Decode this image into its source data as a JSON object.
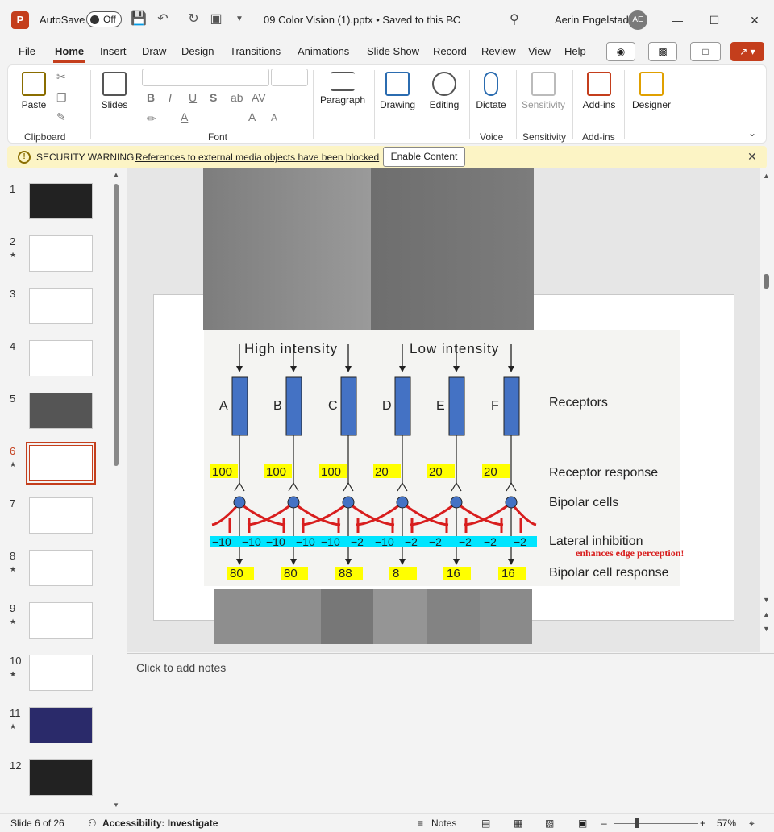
{
  "title_bar": {
    "autosave_label": "AutoSave",
    "autosave_state": "Off",
    "document_title": "09 Color Vision (1).pptx • Saved to this PC",
    "user_name": "Aerin Engelstad",
    "user_initials": "AE"
  },
  "menu": {
    "items": [
      "File",
      "Home",
      "Insert",
      "Draw",
      "Design",
      "Transitions",
      "Animations",
      "Slide Show",
      "Record",
      "Review",
      "View",
      "Help"
    ],
    "active": "Home"
  },
  "ribbon": {
    "paste": "Paste",
    "slides": "Slides",
    "clipboard": "Clipboard",
    "font": "Font",
    "paragraph": "Paragraph",
    "drawing": "Drawing",
    "editing": "Editing",
    "dictate": "Dictate",
    "voice": "Voice",
    "sensitivity_btn": "Sensitivity",
    "sensitivity_group": "Sensitivity",
    "addins_btn": "Add-ins",
    "addins_group": "Add-ins",
    "designer": "Designer",
    "font_buttons": [
      "B",
      "I",
      "U",
      "S",
      "ab",
      "AV",
      "A",
      "A",
      "A"
    ]
  },
  "security": {
    "title": "SECURITY WARNING",
    "message": "References to external media objects have been blocked",
    "button": "Enable Content"
  },
  "thumbnails": {
    "numbers": [
      "1",
      "2",
      "3",
      "4",
      "5",
      "6",
      "7",
      "8",
      "9",
      "10",
      "11",
      "12"
    ],
    "starred": [
      "2",
      "6",
      "8",
      "9",
      "10",
      "11"
    ],
    "active": "6"
  },
  "slide": {
    "high_intensity": "High intensity",
    "low_intensity": "Low intensity",
    "cell_letters": [
      "A",
      "B",
      "C",
      "D",
      "E",
      "F"
    ],
    "receptors_label": "Receptors",
    "receptor_response_label": "Receptor response",
    "bipolar_cells_label": "Bipolar cells",
    "lateral_inhibition_label": "Lateral inhibition",
    "edge_note": "enhances edge perception!",
    "bipolar_response_label": "Bipolar cell response",
    "receptor_responses": [
      "100",
      "100",
      "100",
      "20",
      "20",
      "20"
    ],
    "inhibition_pairs": [
      [
        "−10",
        "−10"
      ],
      [
        "−10",
        "−10"
      ],
      [
        "−10",
        "−2"
      ],
      [
        "−10",
        "−2"
      ],
      [
        "−2",
        "−2"
      ],
      [
        "−2",
        "−2"
      ]
    ],
    "bipolar_responses": [
      "80",
      "80",
      "88",
      "8",
      "16",
      "16"
    ],
    "colors": {
      "receptor_blue": "#4472c4",
      "highlight_yellow": "#ffff00",
      "highlight_cyan": "#00e5ff",
      "inhibition_red": "#d81e1e",
      "note_red": "#d81e1e"
    }
  },
  "notes": {
    "placeholder": "Click to add notes"
  },
  "status": {
    "slide_info": "Slide 6 of 26",
    "accessibility": "Accessibility: Investigate",
    "notes_btn": "Notes",
    "zoom": "57%"
  }
}
